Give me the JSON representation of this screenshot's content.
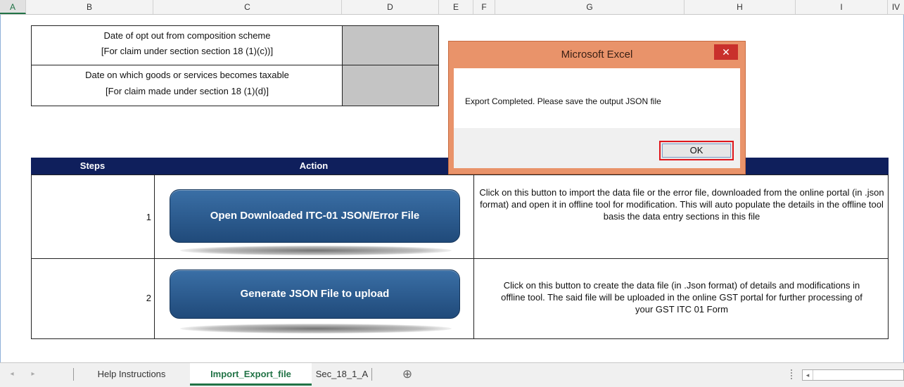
{
  "columns": [
    "A",
    "B",
    "C",
    "D",
    "E",
    "F",
    "G",
    "H",
    "I",
    "IV"
  ],
  "rows": {
    "opt_out_label_1": "Date of opt out from composition scheme",
    "opt_out_label_2": "[For claim under section  section 18 (1)(c))]",
    "taxable_label_1": "Date on which goods or services becomes taxable",
    "taxable_label_2": "[For claim made under section 18 (1)(d)]"
  },
  "table": {
    "headers": [
      "Steps",
      "Action"
    ],
    "steps": [
      {
        "number": "1",
        "button": "Open Downloaded ITC-01 JSON/Error File",
        "description": "Click on this button to import the data file or the error file, downloaded from the online portal (in .json format) and open it in offline tool for modification. This will auto populate the details in the offline tool basis the data entry sections in this file"
      },
      {
        "number": "2",
        "button": "Generate JSON File to upload",
        "description": "Click on this button to create the data file (in .Json format) of details and modifications in offline tool. The said file will be uploaded in the online GST portal for further processing of your GST ITC 01 Form"
      }
    ]
  },
  "dialog": {
    "title": "Microsoft Excel",
    "close": "✕",
    "message": "Export Completed. Please save the output JSON file",
    "ok": "OK"
  },
  "sheet_tabs": {
    "items": [
      "Help Instructions",
      "Import_Export_file",
      "Sec_18_1_A"
    ],
    "active": "Import_Export_file",
    "add_icon": "⊕",
    "nav_prev": "◂",
    "nav_next": "▸",
    "scroll_left": "◂"
  },
  "colors": {
    "header_fill": "#0f1f5c",
    "button_fill": "#2b5a8e",
    "dialog_frame": "#e9936a",
    "ok_highlight": "#e0161c",
    "active_tab": "#217346"
  }
}
